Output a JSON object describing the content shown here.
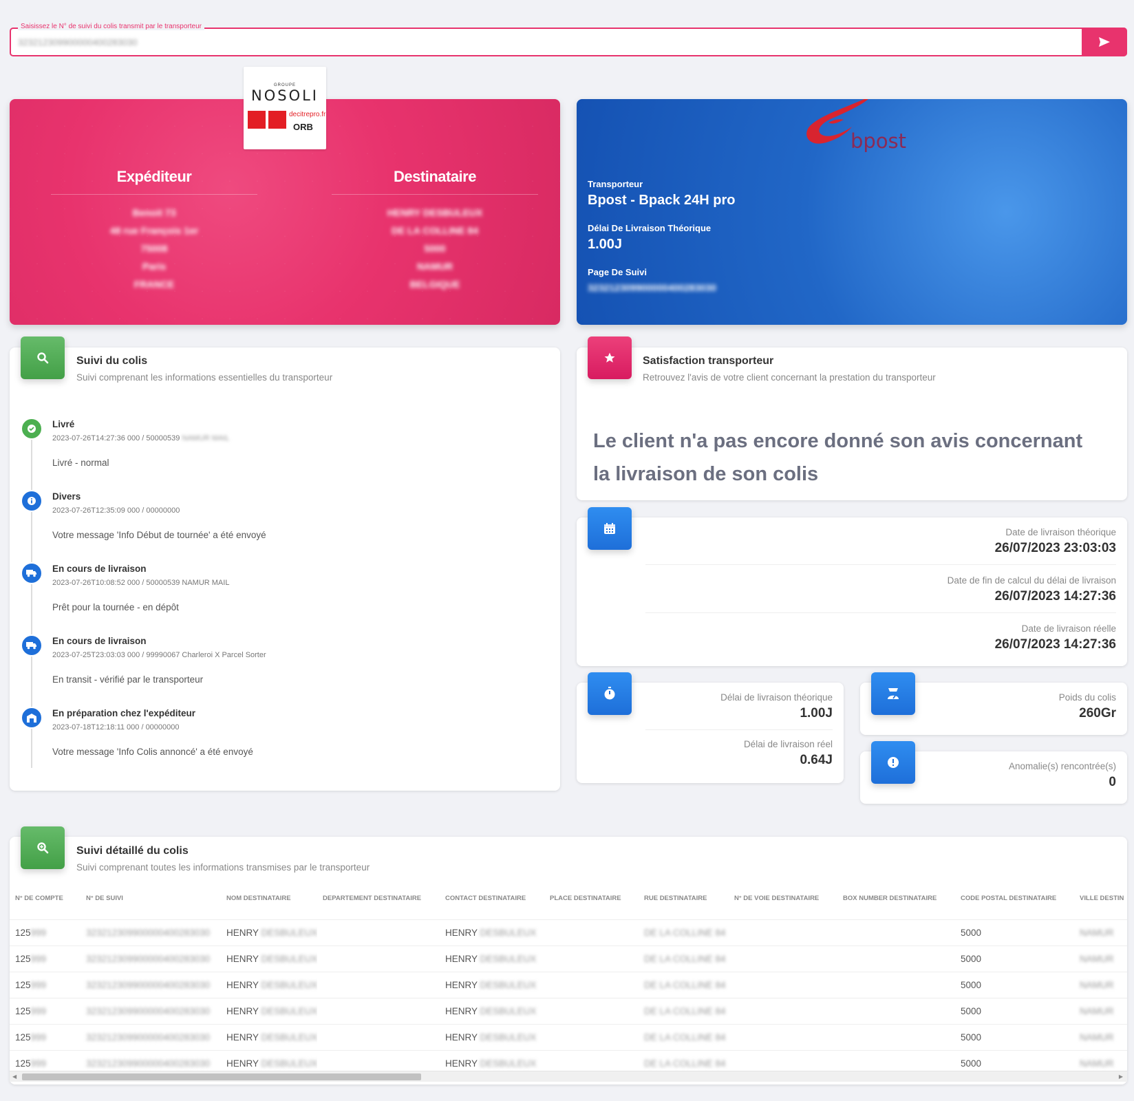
{
  "search": {
    "legend": "Saisissez le N° de suivi du colis transmit par le transporteur",
    "value": "323212309900000400283030"
  },
  "logo": {
    "group": "GROUPE",
    "name": "NOSOLI",
    "deci": "decitrepro.fr",
    "orb": "ORB"
  },
  "sender": {
    "title": "Expéditeur",
    "lines": [
      "Benoit 73",
      "48 rue François 1er",
      "75008",
      "Paris",
      "FRANCE"
    ]
  },
  "recipient": {
    "title": "Destinataire",
    "lines": [
      "HENRY DESBULEUX",
      "DE LA COLLINE 84",
      "5000",
      "NAMUR",
      "BELGIQUE"
    ]
  },
  "carrier": {
    "brand": "bpost",
    "transporteur_label": "Transporteur",
    "transporteur": "Bpost - Bpack 24H pro",
    "delai_label": "Délai De Livraison Théorique",
    "delai": "1.00J",
    "page_label": "Page De Suivi",
    "page_value": "323212309900000400283030",
    "brand_color": "#8c2a55"
  },
  "suivi": {
    "title": "Suivi du colis",
    "subtitle": "Suivi comprenant les informations essentielles du transporteur",
    "events": [
      {
        "status": "Livré",
        "meta": "2023-07-26T14:27:36 000 / 50000539",
        "meta_hidden": "NAMUR MAIL",
        "message": "Livré - normal",
        "icon": "check-circle-icon",
        "color": "#4caf50"
      },
      {
        "status": "Divers",
        "meta": "2023-07-26T12:35:09 000 / 00000000",
        "meta_hidden": "",
        "message": "Votre message 'Info Début de tournée' a été envoyé",
        "icon": "info-icon",
        "color": "#1e6fd9"
      },
      {
        "status": "En cours de livraison",
        "meta": "2023-07-26T10:08:52 000 / 50000539 NAMUR MAIL",
        "meta_hidden": "",
        "message": "Prêt pour la tournée - en dépôt",
        "icon": "truck-icon",
        "color": "#1e6fd9"
      },
      {
        "status": "En cours de livraison",
        "meta": "2023-07-25T23:03:03 000 / 99990067 Charleroi X Parcel Sorter",
        "meta_hidden": "",
        "message": "En transit - vérifié par le transporteur",
        "icon": "truck-icon",
        "color": "#1e6fd9"
      },
      {
        "status": "En préparation chez l'expéditeur",
        "meta": "2023-07-18T12:18:11 000 / 00000000",
        "meta_hidden": "",
        "message": "Votre message 'Info Colis annoncé' a été envoyé",
        "icon": "warehouse-icon",
        "color": "#1e6fd9"
      }
    ]
  },
  "satisfaction": {
    "title": "Satisfaction transporteur",
    "subtitle": "Retrouvez l'avis de votre client concernant la prestation du transporteur",
    "message": "Le client n'a pas encore donné son avis concernant la livraison de son colis"
  },
  "dates": {
    "theorique_label": "Date de livraison théorique",
    "theorique": "26/07/2023 23:03:03",
    "fin_calcul_label": "Date de fin de calcul du délai de livraison",
    "fin_calcul": "26/07/2023 14:27:36",
    "reelle_label": "Date de livraison réelle",
    "reelle": "26/07/2023 14:27:36"
  },
  "delais": {
    "theorique_label": "Délai de livraison théorique",
    "theorique": "1.00J",
    "reel_label": "Délai de livraison réel",
    "reel": "0.64J"
  },
  "poids": {
    "label": "Poids du colis",
    "value": "260Gr"
  },
  "anomalies": {
    "label": "Anomalie(s) rencontrée(s)",
    "value": "0"
  },
  "detail": {
    "title": "Suivi détaillé du colis",
    "subtitle": "Suivi comprenant toutes les informations transmises par le transporteur",
    "columns": [
      "N° de compte",
      "N° de suivi",
      "Nom destinataire",
      "Departement destinataire",
      "Contact destinataire",
      "Place destinataire",
      "Rue destinataire",
      "N° de voie destinataire",
      "Box number destinataire",
      "Code postal destinataire",
      "Ville destin"
    ],
    "rows": [
      {
        "compte": "125",
        "compte_hidden": "999",
        "suivi": "323212309900000400283030",
        "nom": "HENRY",
        "nom_hidden": "DESBULEUX",
        "contact": "HENRY",
        "contact_hidden": "DESBULEUX",
        "rue": "DE LA COLLINE 84",
        "cp": "5000",
        "ville": "NAMUR"
      },
      {
        "compte": "125",
        "compte_hidden": "999",
        "suivi": "323212309900000400283030",
        "nom": "HENRY",
        "nom_hidden": "DESBULEUX",
        "contact": "HENRY",
        "contact_hidden": "DESBULEUX",
        "rue": "DE LA COLLINE 84",
        "cp": "5000",
        "ville": "NAMUR"
      },
      {
        "compte": "125",
        "compte_hidden": "999",
        "suivi": "323212309900000400283030",
        "nom": "HENRY",
        "nom_hidden": "DESBULEUX",
        "contact": "HENRY",
        "contact_hidden": "DESBULEUX",
        "rue": "DE LA COLLINE 84",
        "cp": "5000",
        "ville": "NAMUR"
      },
      {
        "compte": "125",
        "compte_hidden": "999",
        "suivi": "323212309900000400283030",
        "nom": "HENRY",
        "nom_hidden": "DESBULEUX",
        "contact": "HENRY",
        "contact_hidden": "DESBULEUX",
        "rue": "DE LA COLLINE 84",
        "cp": "5000",
        "ville": "NAMUR"
      },
      {
        "compte": "125",
        "compte_hidden": "999",
        "suivi": "323212309900000400283030",
        "nom": "HENRY",
        "nom_hidden": "DESBULEUX",
        "contact": "HENRY",
        "contact_hidden": "DESBULEUX",
        "rue": "DE LA COLLINE 84",
        "cp": "5000",
        "ville": "NAMUR"
      },
      {
        "compte": "125",
        "compte_hidden": "999",
        "suivi": "323212309900000400283030",
        "nom": "HENRY",
        "nom_hidden": "DESBULEUX",
        "contact": "HENRY",
        "contact_hidden": "DESBULEUX",
        "rue": "DE LA COLLINE 84",
        "cp": "5000",
        "ville": "NAMUR"
      }
    ]
  },
  "colors": {
    "accent_pink": "#e8336d",
    "accent_blue": "#1e6fd9",
    "accent_green": "#4caf50"
  }
}
